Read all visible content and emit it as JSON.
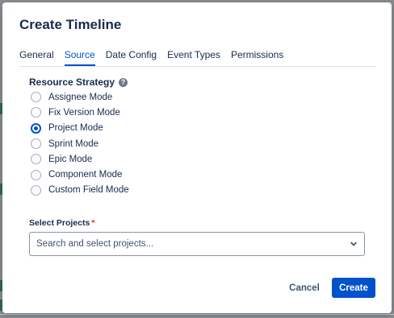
{
  "dialog": {
    "title": "Create Timeline",
    "tabs": [
      {
        "label": "General",
        "active": false
      },
      {
        "label": "Source",
        "active": true
      },
      {
        "label": "Date Config",
        "active": false
      },
      {
        "label": "Event Types",
        "active": false
      },
      {
        "label": "Permissions",
        "active": false
      }
    ],
    "resource_strategy": {
      "label": "Resource Strategy",
      "help_icon": "help-icon",
      "options": [
        {
          "label": "Assignee Mode",
          "checked": false
        },
        {
          "label": "Fix Version Mode",
          "checked": false
        },
        {
          "label": "Project Mode",
          "checked": true
        },
        {
          "label": "Sprint Mode",
          "checked": false
        },
        {
          "label": "Epic Mode",
          "checked": false
        },
        {
          "label": "Component Mode",
          "checked": false
        },
        {
          "label": "Custom Field Mode",
          "checked": false
        }
      ]
    },
    "select_projects": {
      "label": "Select Projects",
      "required_marker": "*",
      "placeholder": "Search and select projects...",
      "icon": "chevron-down-icon"
    },
    "footer": {
      "cancel_label": "Cancel",
      "create_label": "Create"
    }
  },
  "colors": {
    "accent": "#0052cc",
    "required": "#de350b",
    "text": "#172b4d"
  }
}
